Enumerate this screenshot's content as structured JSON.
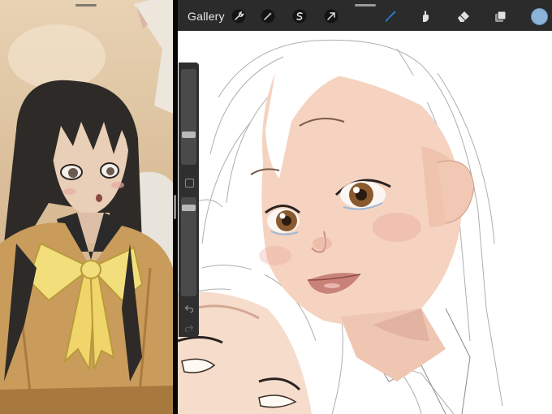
{
  "top_bar": {
    "gallery_label": "Gallery",
    "tools_left": [
      "wrench-icon",
      "magic-wand-icon",
      "selection-s-icon",
      "transform-arrow-icon"
    ],
    "tools_right": [
      "brush-icon",
      "smudge-icon",
      "eraser-icon",
      "layers-icon"
    ],
    "active_tool": "brush-icon",
    "active_color": "#8bb4d9"
  },
  "sidebar": {
    "brush_size_level": 0.3,
    "opacity_level": 0.08,
    "modify_label": "",
    "undo": "undo-arrow-icon",
    "redo": "redo-arrow-icon"
  },
  "colors": {
    "accent": "#2e7fd9",
    "toolbar": "#2b2b2b",
    "skin": "#f5d3c0",
    "hair_reference": "#2e2a27",
    "ribbon": "#f3de7c",
    "uniform": "#c99c5c"
  }
}
